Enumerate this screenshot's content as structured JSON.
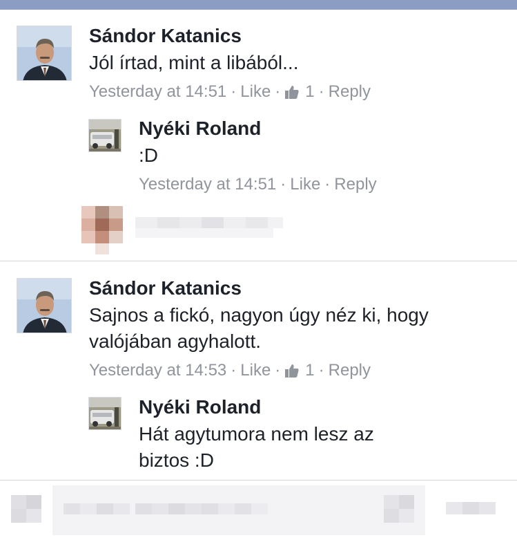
{
  "comments": [
    {
      "author": "Sándor Katanics",
      "text": "Jól írtad, mint a libából...",
      "time": "Yesterday at 14:51",
      "like_label": "Like",
      "like_count": "1",
      "reply_label": "Reply",
      "reply": {
        "author": "Nyéki Roland",
        "text": ":D",
        "time": "Yesterday at 14:51",
        "like_label": "Like",
        "reply_label": "Reply"
      }
    },
    {
      "author": "Sándor Katanics",
      "text": "Sajnos a fickó, nagyon úgy néz ki, hogy valójában agyhalott.",
      "time": "Yesterday at 14:53",
      "like_label": "Like",
      "like_count": "1",
      "reply_label": "Reply",
      "reply": {
        "author": "Nyéki Roland",
        "text": "Hát agytumora nem lesz az biztos :D"
      }
    }
  ],
  "separator": "·",
  "colors": {
    "top_bar": "#8b9dc3",
    "name": "#1d2129",
    "meta": "#90949c",
    "divider": "#d3d6db"
  },
  "icons": {
    "like": "thumbs-up-icon"
  }
}
